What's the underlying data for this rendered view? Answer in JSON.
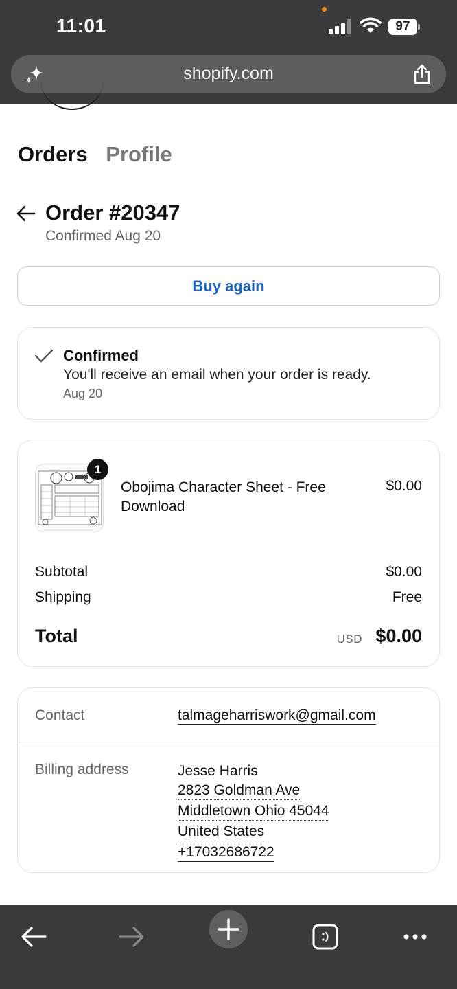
{
  "status_bar": {
    "time": "11:01",
    "battery": "97"
  },
  "browser": {
    "url": "shopify.com"
  },
  "tabs": {
    "orders": "Orders",
    "profile": "Profile"
  },
  "order": {
    "title": "Order #20347",
    "subtitle": "Confirmed Aug 20"
  },
  "buy_again_label": "Buy again",
  "status_card": {
    "title": "Confirmed",
    "message": "You'll receive an email when your order is ready.",
    "date": "Aug 20"
  },
  "items_card": {
    "item": {
      "quantity": "1",
      "name": "Obojima Character Sheet - Free Download",
      "price": "$0.00"
    },
    "subtotal_label": "Subtotal",
    "subtotal_value": "$0.00",
    "shipping_label": "Shipping",
    "shipping_value": "Free",
    "total_label": "Total",
    "total_currency": "USD",
    "total_value": "$0.00"
  },
  "contact_card": {
    "contact_label": "Contact",
    "contact_value": "talmageharriswork@gmail.com",
    "billing_label": "Billing address",
    "billing_lines": [
      "Jesse Harris",
      "2823 Goldman Ave",
      "Middletown Ohio 45044",
      "United States",
      "+17032686722"
    ]
  },
  "toolbar": {
    "icons": [
      "back-arrow-icon",
      "forward-arrow-icon",
      "plus-icon",
      "tabs-icon",
      "more-icon"
    ]
  }
}
